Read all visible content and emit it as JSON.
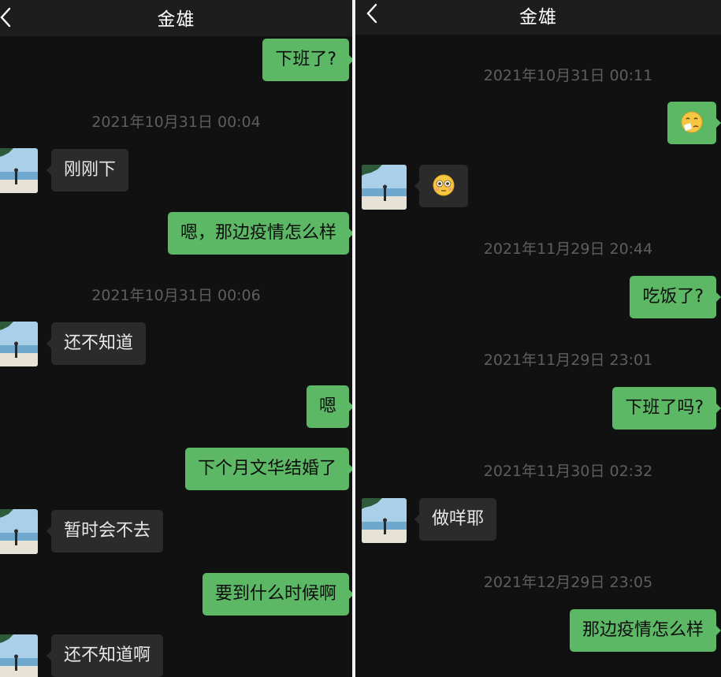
{
  "left": {
    "title": "金雄",
    "timestamps": [
      "2021年10月31日 00:04",
      "2021年10月31日 00:06"
    ],
    "messages": [
      {
        "from": "me",
        "text": "下班了?"
      },
      {
        "from": "contact",
        "text": "刚刚下"
      },
      {
        "from": "me",
        "text": "嗯，那边疫情怎么样"
      },
      {
        "from": "contact",
        "text": "还不知道"
      },
      {
        "from": "me",
        "text": "嗯"
      },
      {
        "from": "me",
        "text": "下个月文华结婚了"
      },
      {
        "from": "contact",
        "text": "暂时会不去"
      },
      {
        "from": "me",
        "text": "要到什么时候啊"
      },
      {
        "from": "contact",
        "text": "还不知道啊"
      }
    ]
  },
  "right": {
    "title": "金雄",
    "timestamps": [
      "2021年10月31日 00:11",
      "2021年11月29日 20:44",
      "2021年11月29日 23:01",
      "2021年11月30日 02:32",
      "2021年12月29日 23:05"
    ],
    "messages": [
      {
        "from": "me",
        "emoji": "sneezing-face-emoji"
      },
      {
        "from": "contact",
        "emoji": "flushed-face-emoji"
      },
      {
        "from": "me",
        "text": "吃饭了?"
      },
      {
        "from": "me",
        "text": "下班了吗?"
      },
      {
        "from": "contact",
        "text": "做咩耶"
      },
      {
        "from": "me",
        "text": "那边疫情怎么样"
      }
    ]
  },
  "colors": {
    "background": "#111111",
    "header": "#1d1d1d",
    "outgoing_bubble": "#5cb864",
    "incoming_bubble": "#2b2b2b",
    "timestamp": "#5e5e5e"
  }
}
